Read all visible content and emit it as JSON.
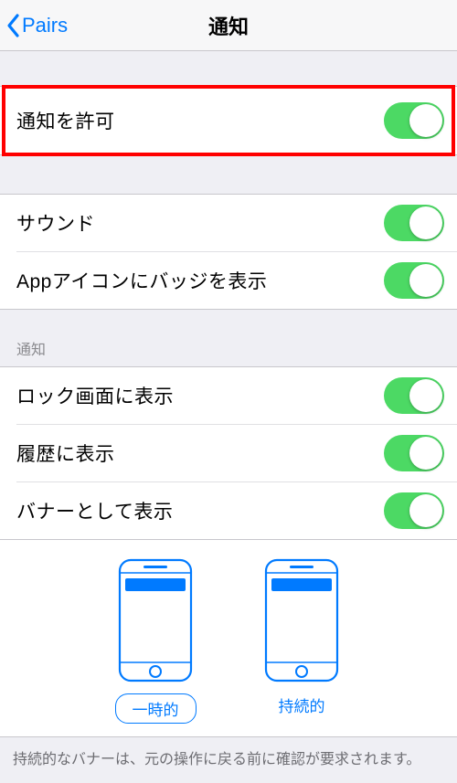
{
  "header": {
    "back_label": "Pairs",
    "title": "通知"
  },
  "allow": {
    "label": "通知を許可",
    "on": true
  },
  "sound": {
    "label": "サウンド",
    "on": true
  },
  "badge": {
    "label": "Appアイコンにバッジを表示",
    "on": true
  },
  "section_label": "通知",
  "lock": {
    "label": "ロック画面に表示",
    "on": true
  },
  "history": {
    "label": "履歴に表示",
    "on": true
  },
  "banner": {
    "label": "バナーとして表示",
    "on": true
  },
  "banner_style": {
    "temporary": "一時的",
    "persistent": "持続的",
    "selected": "temporary"
  },
  "footer": "持続的なバナーは、元の操作に戻る前に確認が要求されます。"
}
